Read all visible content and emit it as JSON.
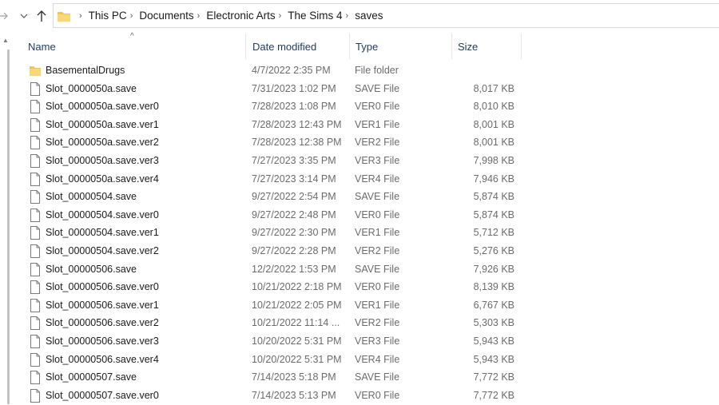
{
  "address": {
    "crumbs": [
      "This PC",
      "Documents",
      "Electronic Arts",
      "The Sims 4",
      "saves"
    ]
  },
  "columns": {
    "name": "Name",
    "date": "Date modified",
    "type": "Type",
    "size": "Size"
  },
  "colors": {
    "folder": "#f3c445",
    "header_text": "#1f3a5c"
  },
  "files": [
    {
      "icon": "folder-icon",
      "name": "BasementalDrugs",
      "date": "4/7/2022 2:35 PM",
      "type": "File folder",
      "size": ""
    },
    {
      "icon": "file-icon",
      "name": "Slot_0000050a.save",
      "date": "7/31/2023 1:02 PM",
      "type": "SAVE File",
      "size": "8,017 KB"
    },
    {
      "icon": "file-icon",
      "name": "Slot_0000050a.save.ver0",
      "date": "7/28/2023 1:08 PM",
      "type": "VER0 File",
      "size": "8,010 KB"
    },
    {
      "icon": "file-icon",
      "name": "Slot_0000050a.save.ver1",
      "date": "7/28/2023 12:43 PM",
      "type": "VER1 File",
      "size": "8,001 KB"
    },
    {
      "icon": "file-icon",
      "name": "Slot_0000050a.save.ver2",
      "date": "7/28/2023 12:38 PM",
      "type": "VER2 File",
      "size": "8,001 KB"
    },
    {
      "icon": "file-icon",
      "name": "Slot_0000050a.save.ver3",
      "date": "7/27/2023 3:35 PM",
      "type": "VER3 File",
      "size": "7,998 KB"
    },
    {
      "icon": "file-icon",
      "name": "Slot_0000050a.save.ver4",
      "date": "7/27/2023 3:14 PM",
      "type": "VER4 File",
      "size": "7,946 KB"
    },
    {
      "icon": "file-icon",
      "name": "Slot_00000504.save",
      "date": "9/27/2022 2:54 PM",
      "type": "SAVE File",
      "size": "5,874 KB"
    },
    {
      "icon": "file-icon",
      "name": "Slot_00000504.save.ver0",
      "date": "9/27/2022 2:48 PM",
      "type": "VER0 File",
      "size": "5,874 KB"
    },
    {
      "icon": "file-icon",
      "name": "Slot_00000504.save.ver1",
      "date": "9/27/2022 2:30 PM",
      "type": "VER1 File",
      "size": "5,712 KB"
    },
    {
      "icon": "file-icon",
      "name": "Slot_00000504.save.ver2",
      "date": "9/27/2022 2:28 PM",
      "type": "VER2 File",
      "size": "5,276 KB"
    },
    {
      "icon": "file-icon",
      "name": "Slot_00000506.save",
      "date": "12/2/2022 1:53 PM",
      "type": "SAVE File",
      "size": "7,926 KB"
    },
    {
      "icon": "file-icon",
      "name": "Slot_00000506.save.ver0",
      "date": "10/21/2022 2:18 PM",
      "type": "VER0 File",
      "size": "8,139 KB"
    },
    {
      "icon": "file-icon",
      "name": "Slot_00000506.save.ver1",
      "date": "10/21/2022 2:05 PM",
      "type": "VER1 File",
      "size": "6,767 KB"
    },
    {
      "icon": "file-icon",
      "name": "Slot_00000506.save.ver2",
      "date": "10/21/2022 11:14 ...",
      "type": "VER2 File",
      "size": "5,303 KB"
    },
    {
      "icon": "file-icon",
      "name": "Slot_00000506.save.ver3",
      "date": "10/20/2022 5:31 PM",
      "type": "VER3 File",
      "size": "5,943 KB"
    },
    {
      "icon": "file-icon",
      "name": "Slot_00000506.save.ver4",
      "date": "10/20/2022 5:31 PM",
      "type": "VER4 File",
      "size": "5,943 KB"
    },
    {
      "icon": "file-icon",
      "name": "Slot_00000507.save",
      "date": "7/14/2023 5:18 PM",
      "type": "SAVE File",
      "size": "7,772 KB"
    },
    {
      "icon": "file-icon",
      "name": "Slot_00000507.save.ver0",
      "date": "7/14/2023 5:13 PM",
      "type": "VER0 File",
      "size": "7,772 KB"
    }
  ]
}
